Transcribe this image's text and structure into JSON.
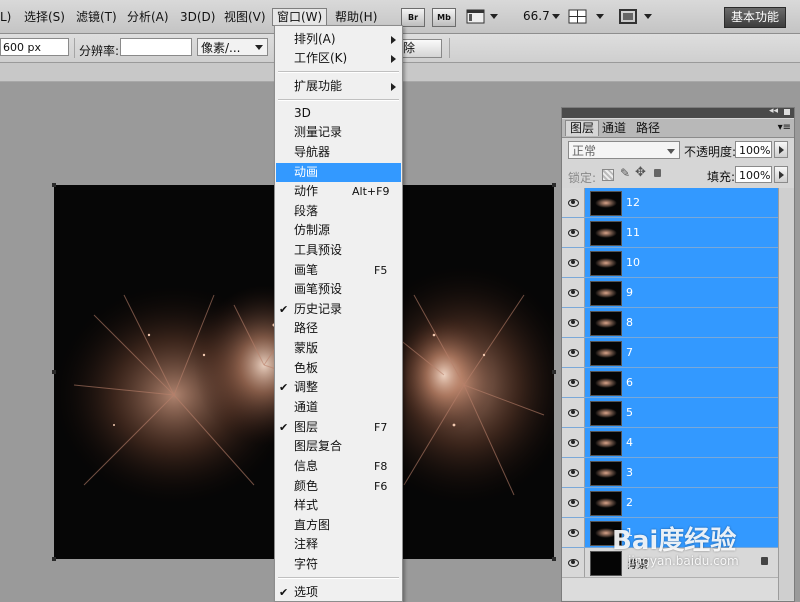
{
  "menubar": {
    "items": [
      "L)",
      "选择(S)",
      "滤镜(T)",
      "分析(A)",
      "3D(D)",
      "视图(V)",
      "窗口(W)",
      "帮助(H)"
    ],
    "badges": [
      "Br",
      "Mb"
    ],
    "zoom": "66.7",
    "workspace": "基本功能"
  },
  "options": {
    "width_value": "600 px",
    "resolution_label": "分辨率:",
    "resolution_unit": "像素/...",
    "clear_label": "除"
  },
  "window_menu": {
    "items": [
      {
        "label": "排列(A)",
        "shortcut": "",
        "checked": false,
        "submenu": true
      },
      {
        "label": "工作区(K)",
        "shortcut": "",
        "checked": false,
        "submenu": true
      },
      {
        "label": "扩展功能",
        "shortcut": "",
        "checked": false,
        "submenu": true
      },
      {
        "label": "3D",
        "shortcut": "",
        "checked": false,
        "submenu": false
      },
      {
        "label": "测量记录",
        "shortcut": "",
        "checked": false,
        "submenu": false
      },
      {
        "label": "导航器",
        "shortcut": "",
        "checked": false,
        "submenu": false
      },
      {
        "label": "动画",
        "shortcut": "",
        "checked": false,
        "submenu": false,
        "highlighted": true
      },
      {
        "label": "动作",
        "shortcut": "Alt+F9",
        "checked": false,
        "submenu": false
      },
      {
        "label": "段落",
        "shortcut": "",
        "checked": false,
        "submenu": false
      },
      {
        "label": "仿制源",
        "shortcut": "",
        "checked": false,
        "submenu": false
      },
      {
        "label": "工具预设",
        "shortcut": "",
        "checked": false,
        "submenu": false
      },
      {
        "label": "画笔",
        "shortcut": "F5",
        "checked": false,
        "submenu": false
      },
      {
        "label": "画笔预设",
        "shortcut": "",
        "checked": false,
        "submenu": false
      },
      {
        "label": "历史记录",
        "shortcut": "",
        "checked": true,
        "submenu": false
      },
      {
        "label": "路径",
        "shortcut": "",
        "checked": false,
        "submenu": false
      },
      {
        "label": "蒙版",
        "shortcut": "",
        "checked": false,
        "submenu": false
      },
      {
        "label": "色板",
        "shortcut": "",
        "checked": false,
        "submenu": false
      },
      {
        "label": "调整",
        "shortcut": "",
        "checked": true,
        "submenu": false
      },
      {
        "label": "通道",
        "shortcut": "",
        "checked": false,
        "submenu": false
      },
      {
        "label": "图层",
        "shortcut": "F7",
        "checked": true,
        "submenu": false
      },
      {
        "label": "图层复合",
        "shortcut": "",
        "checked": false,
        "submenu": false
      },
      {
        "label": "信息",
        "shortcut": "F8",
        "checked": false,
        "submenu": false
      },
      {
        "label": "颜色",
        "shortcut": "F6",
        "checked": false,
        "submenu": false
      },
      {
        "label": "样式",
        "shortcut": "",
        "checked": false,
        "submenu": false
      },
      {
        "label": "直方图",
        "shortcut": "",
        "checked": false,
        "submenu": false
      },
      {
        "label": "注释",
        "shortcut": "",
        "checked": false,
        "submenu": false
      },
      {
        "label": "字符",
        "shortcut": "",
        "checked": false,
        "submenu": false
      },
      {
        "label": "选项",
        "shortcut": "",
        "checked": true,
        "submenu": false
      }
    ]
  },
  "layers_panel": {
    "tabs": [
      "图层",
      "通道",
      "路径"
    ],
    "blend_mode": "正常",
    "opacity_label": "不透明度:",
    "opacity_value": "100%",
    "lock_label": "锁定:",
    "fill_label": "填充:",
    "fill_value": "100%",
    "layers": [
      "12",
      "11",
      "10",
      "9",
      "8",
      "7",
      "6",
      "5",
      "4",
      "3",
      "2",
      "1",
      "背景"
    ]
  },
  "watermark": {
    "text": "Bai度经验",
    "sub": "jingyan.baidu.com"
  },
  "colors": {
    "highlight": "#3399ff",
    "menubar": "#c8c8c8",
    "canvas": "#060606"
  }
}
